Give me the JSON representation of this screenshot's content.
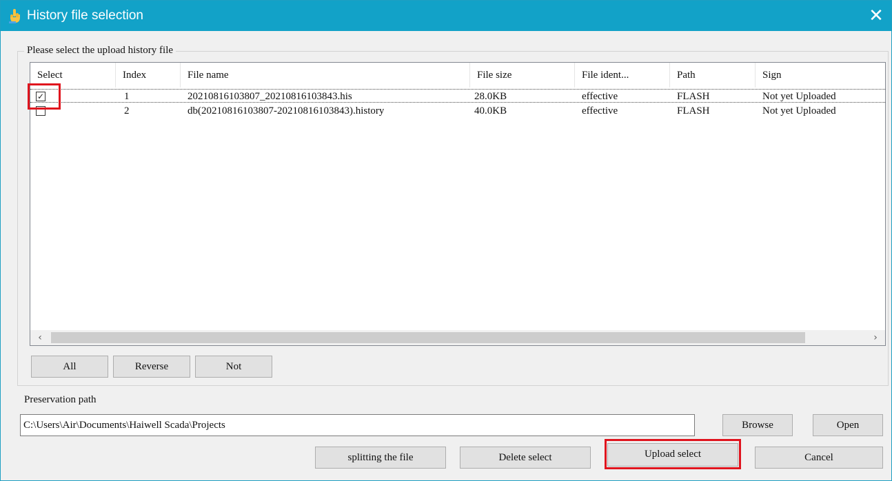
{
  "window": {
    "title": "History file selection",
    "close_glyph": "✕",
    "title_icon": "hand-pointer-icon",
    "title_bar_color": "#12a2c8"
  },
  "group": {
    "label": "Please select the upload history file"
  },
  "table": {
    "columns": [
      "Select",
      "Index",
      "File name",
      "File size",
      "File ident...",
      "Path",
      "Sign"
    ],
    "rows": [
      {
        "checked": true,
        "index": "1",
        "file_name": "20210816103807_20210816103843.his",
        "file_size": "28.0KB",
        "file_ident": "effective",
        "path": "FLASH",
        "sign": "Not yet Uploaded"
      },
      {
        "checked": false,
        "index": "2",
        "file_name": "db(20210816103807-20210816103843).history",
        "file_size": "40.0KB",
        "file_ident": "effective",
        "path": "FLASH",
        "sign": "Not yet Uploaded"
      }
    ]
  },
  "scrollbar": {
    "left_arrow": "‹",
    "right_arrow": "›"
  },
  "selection_buttons": {
    "all": "All",
    "reverse": "Reverse",
    "not": "Not"
  },
  "preservation": {
    "label": "Preservation path",
    "value": "C:\\Users\\Air\\Documents\\Haiwell Scada\\Projects",
    "browse": "Browse",
    "open": "Open"
  },
  "actions": {
    "split": "splitting the file",
    "delete": "Delete select",
    "upload": "Upload select",
    "cancel": "Cancel"
  },
  "highlight_color": "#e0141e"
}
